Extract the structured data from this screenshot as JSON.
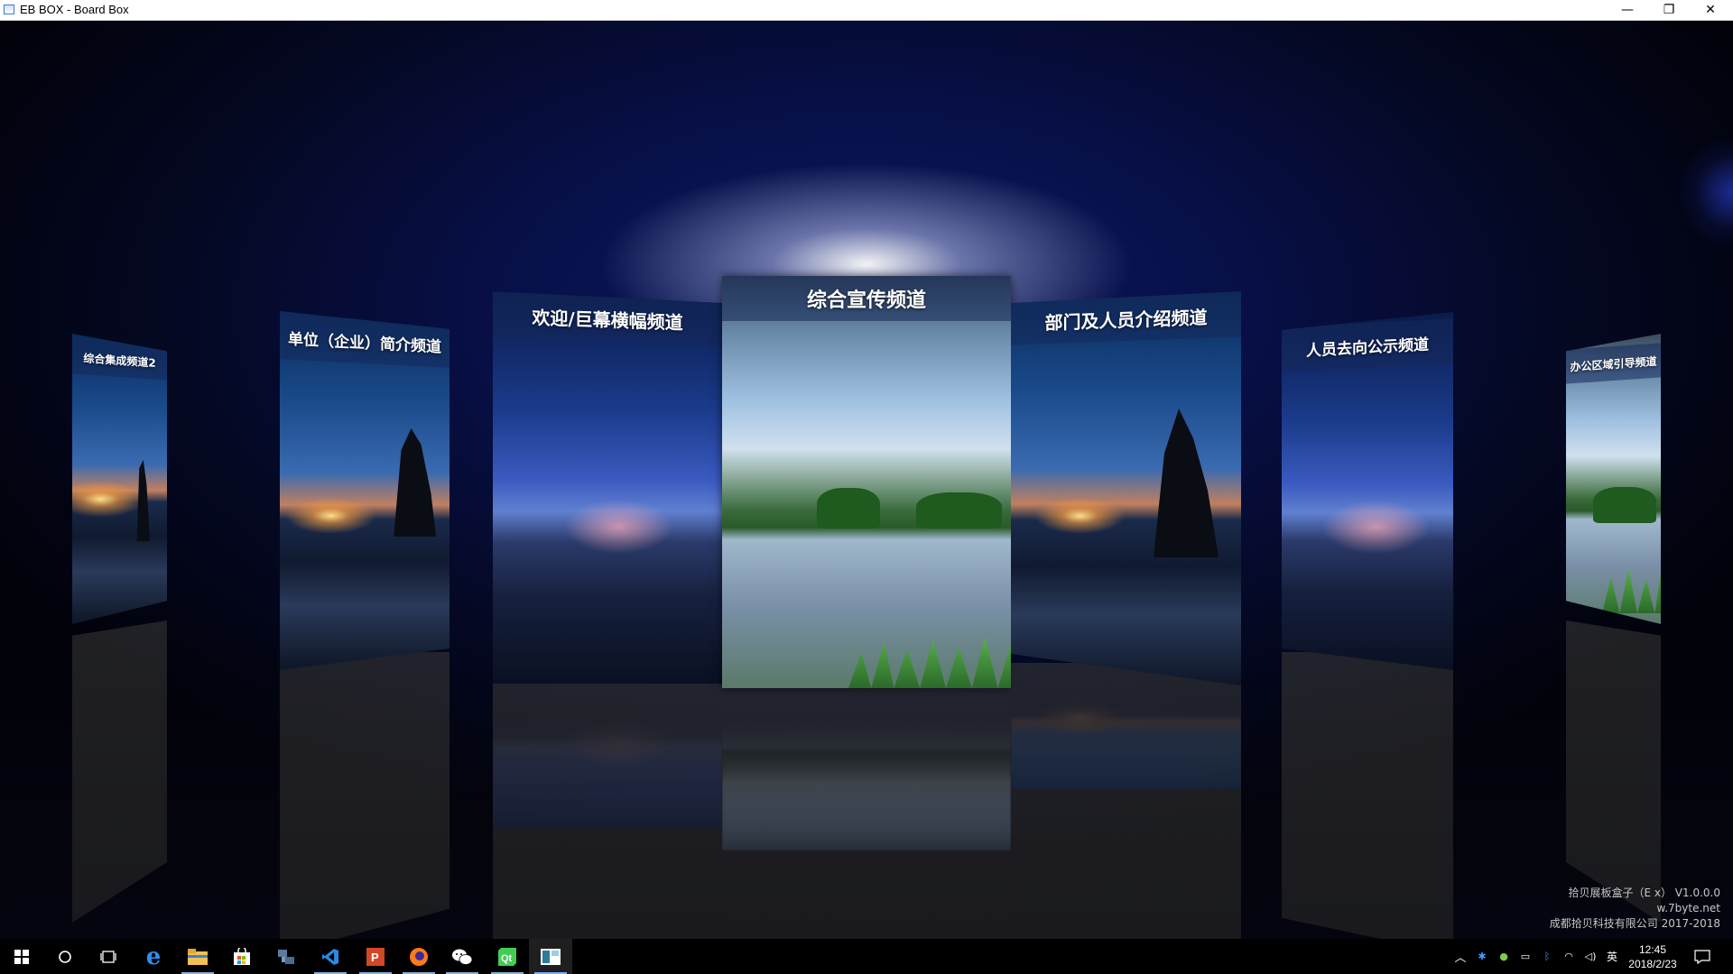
{
  "window": {
    "title": "EB BOX - Board Box",
    "controls": {
      "minimize": "—",
      "maximize": "❐",
      "close": "✕"
    }
  },
  "channels": [
    {
      "label": "综合集成频道2",
      "image": "sunset-rock"
    },
    {
      "label": "单位（企业）简介频道",
      "image": "sunset-rock"
    },
    {
      "label": "欢迎/巨幕横幅频道",
      "image": "blue-dusk-coast"
    },
    {
      "label": "综合宣传频道",
      "image": "green-lake",
      "selected": true
    },
    {
      "label": "部门及人员介绍频道",
      "image": "sunset-rock"
    },
    {
      "label": "人员去向公示频道",
      "image": "blue-dusk-coast"
    },
    {
      "label": "办公区域引导频道",
      "image": "green-lake"
    }
  ],
  "version_info": {
    "line1": "拾贝展板盒子（E          x）  V1.0.0.0",
    "line2": "w.7byte.net",
    "line3": "成都拾贝科技有限公司  2017-2018"
  },
  "taskbar": {
    "apps": [
      "start-icon",
      "search-circle-icon",
      "task-view-icon",
      "edge-icon",
      "file-explorer-icon",
      "store-icon",
      "network-tool-icon",
      "vscode-icon",
      "powerpoint-icon",
      "firefox-icon",
      "wechat-icon",
      "qt-icon",
      "ebbox-icon"
    ],
    "tray_ime": "英",
    "clock_time": "12:45",
    "clock_date": "2018/2/23"
  },
  "colors": {
    "background": "#050a2a",
    "glow": "#ffffff",
    "header_band": "#142a5a",
    "taskbar": "#000000",
    "accent": "#7ab0ff"
  }
}
